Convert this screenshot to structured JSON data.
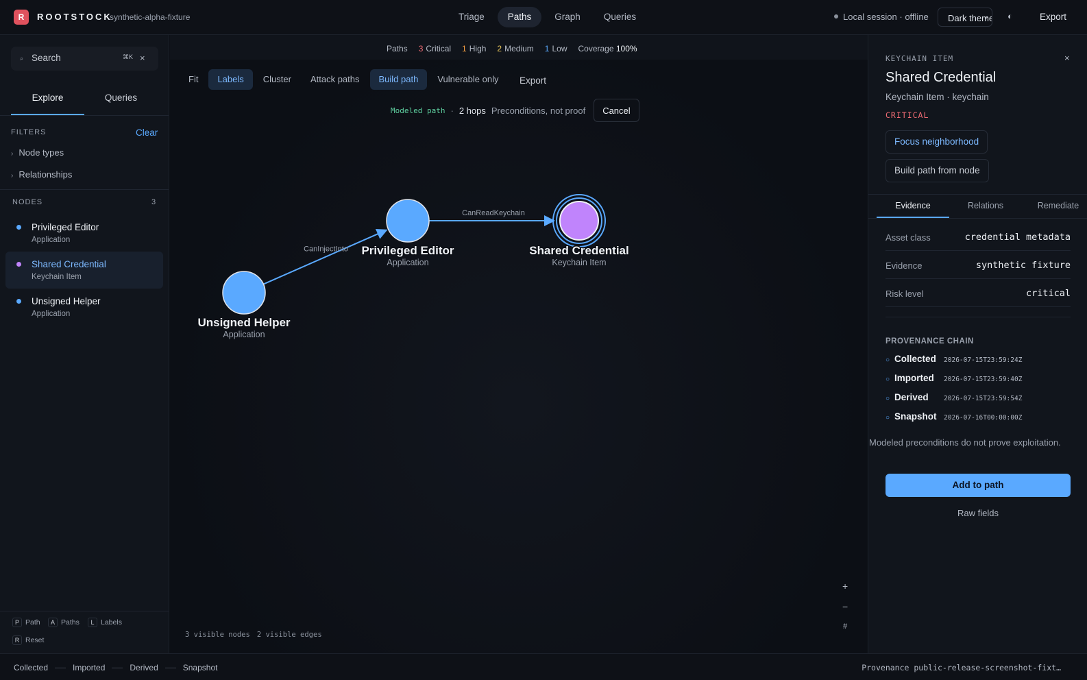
{
  "app": {
    "logo_letter": "R",
    "brand": "ROOTSTOCK",
    "fixture": "synthetic-alpha-fixture"
  },
  "nav": {
    "tabs": [
      "Triage",
      "Paths",
      "Graph",
      "Queries"
    ],
    "active": "Paths"
  },
  "session": {
    "status": "Local session · offline",
    "theme": "Dark theme",
    "export": "Export"
  },
  "sidebar": {
    "search_placeholder": "Search",
    "search_shortcut": "⌘K",
    "tabs": [
      "Explore",
      "Queries"
    ],
    "filters": {
      "title": "FILTERS",
      "clear": "Clear",
      "items": [
        "Node types",
        "Relationships"
      ]
    },
    "nodes": {
      "title": "NODES",
      "count": "3",
      "items": [
        {
          "label": "Privileged Editor",
          "type": "Application",
          "color": "#5aa9ff",
          "selected": false
        },
        {
          "label": "Shared Credential",
          "type": "Keychain Item",
          "color": "#c084fc",
          "selected": true
        },
        {
          "label": "Unsigned Helper",
          "type": "Application",
          "color": "#5aa9ff",
          "selected": false
        }
      ]
    },
    "shortcuts": [
      {
        "key": "P",
        "label": "Path"
      },
      {
        "key": "A",
        "label": "Paths"
      },
      {
        "key": "L",
        "label": "Labels"
      },
      {
        "key": "R",
        "label": "Reset"
      }
    ]
  },
  "stats": {
    "paths_label": "Paths",
    "critical": {
      "count": "3",
      "label": "Critical",
      "color": "#ef6b73"
    },
    "high": {
      "count": "1",
      "label": "High",
      "color": "#f59e42"
    },
    "medium": {
      "count": "2",
      "label": "Medium",
      "color": "#e8c55a"
    },
    "low": {
      "count": "1",
      "label": "Low",
      "color": "#5aa9ff"
    },
    "coverage_label": "Coverage",
    "coverage": "100%"
  },
  "toolbar": {
    "buttons": [
      {
        "label": "Fit",
        "active": false
      },
      {
        "label": "Labels",
        "active": true
      },
      {
        "label": "Cluster",
        "active": false
      },
      {
        "label": "Attack paths",
        "active": false
      },
      {
        "label": "Build path",
        "active": true
      },
      {
        "label": "Vulnerable only",
        "active": false
      }
    ],
    "export": "Export"
  },
  "pathbar": {
    "modeled": "Modeled path",
    "sep": "·",
    "hops": "2 hops",
    "note": "Preconditions, not proof",
    "cancel": "Cancel"
  },
  "graph": {
    "nodes": [
      {
        "id": "unsigned",
        "label": "Unsigned Helper",
        "type": "Application",
        "color": "#5aa9ff"
      },
      {
        "id": "editor",
        "label": "Privileged Editor",
        "type": "Application",
        "color": "#5aa9ff"
      },
      {
        "id": "credential",
        "label": "Shared Credential",
        "type": "Keychain Item",
        "color": "#c084fc"
      }
    ],
    "edges": [
      {
        "from": "unsigned",
        "to": "editor",
        "label": "CanInjectInto"
      },
      {
        "from": "editor",
        "to": "credential",
        "label": "CanReadKeychain"
      }
    ],
    "visible_nodes": "3 visible nodes",
    "visible_edges": "2 visible edges"
  },
  "detail": {
    "kind": "KEYCHAIN ITEM",
    "title": "Shared Credential",
    "subtitle": "Keychain Item · keychain",
    "severity": "CRITICAL",
    "focus": "Focus neighborhood",
    "build": "Build path from node",
    "tabs": [
      "Evidence",
      "Relations",
      "Remediate"
    ],
    "fields": [
      {
        "key": "Asset class",
        "value": "credential metadata"
      },
      {
        "key": "Evidence",
        "value": "synthetic fixture"
      },
      {
        "key": "Risk level",
        "value": "critical"
      }
    ],
    "provenance_title": "PROVENANCE CHAIN",
    "provenance": [
      {
        "name": "Collected",
        "time": "2026-07-15T23:59:24Z"
      },
      {
        "name": "Imported",
        "time": "2026-07-15T23:59:40Z"
      },
      {
        "name": "Derived",
        "time": "2026-07-15T23:59:54Z"
      },
      {
        "name": "Snapshot",
        "time": "2026-07-16T00:00:00Z"
      }
    ],
    "note": "Modeled preconditions do not prove exploitation.",
    "add": "Add to path",
    "raw": "Raw fields"
  },
  "footer": {
    "timeline": [
      "Collected",
      "Imported",
      "Derived",
      "Snapshot"
    ],
    "provenance": "Provenance public-release-screenshot-fixt…"
  }
}
